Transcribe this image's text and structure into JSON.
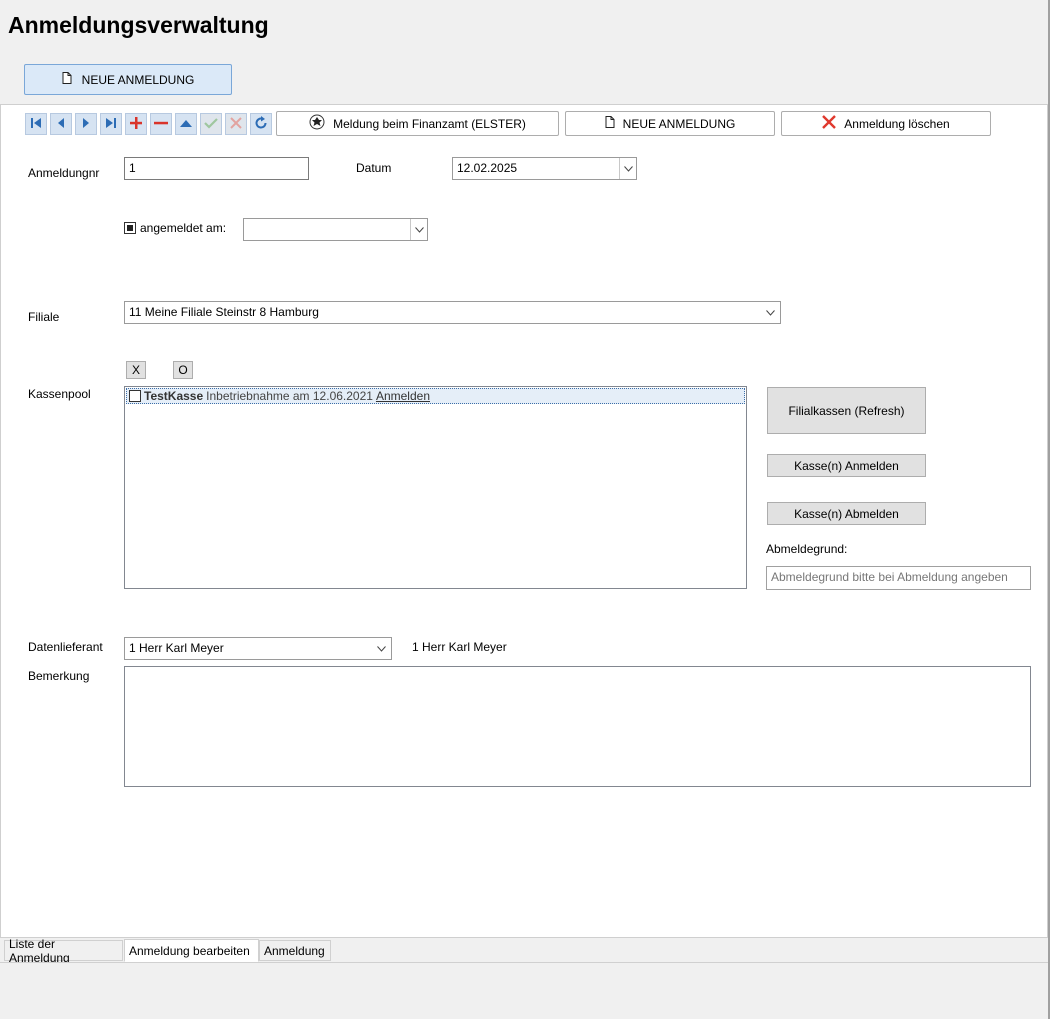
{
  "app": {
    "title": "Anmeldungsverwaltung"
  },
  "header": {
    "new_label": "NEUE ANMELDUNG"
  },
  "toolbar": {
    "elster_label": "Meldung beim Finanzamt (ELSTER)",
    "new_label": "NEUE ANMELDUNG",
    "delete_label": "Anmeldung löschen",
    "nav_icons": [
      "first-icon",
      "prev-icon",
      "next-icon",
      "last-icon",
      "add-icon",
      "remove-icon",
      "up-icon",
      "confirm-icon",
      "cancel-icon",
      "refresh-icon"
    ]
  },
  "form": {
    "anmeldungnr_label": "Anmeldungnr",
    "anmeldungnr_value": "1",
    "datum_label": "Datum",
    "datum_value": "12.02.2025",
    "angemeldet_label": "angemeldet am:",
    "angemeldet_value": "",
    "filiale_label": "Filiale",
    "filiale_value": "11 Meine Filiale Steinstr 8 Hamburg",
    "kassenpool_label": "Kassenpool",
    "x_label": "X",
    "o_label": "O",
    "kassen": [
      {
        "name": "TestKasse",
        "info": "Inbetriebnahme am 12.06.2021",
        "link": "Anmelden"
      }
    ],
    "refresh_label": "Filialkassen (Refresh)",
    "anmelden_label": "Kasse(n) Anmelden",
    "abmelden_label": "Kasse(n) Abmelden",
    "abmeldegrund_label": "Abmeldegrund:",
    "abmeldegrund_placeholder": "Abmeldegrund bitte bei Abmeldung angeben",
    "datenlieferant_label": "Datenlieferant",
    "datenlieferant_value": "1 Herr  Karl Meyer",
    "datenlieferant_display": "1 Herr  Karl Meyer",
    "bemerkung_label": "Bemerkung",
    "bemerkung_value": ""
  },
  "tabs": [
    {
      "label": "Liste der Anmeldung"
    },
    {
      "label": "Anmeldung bearbeiten"
    },
    {
      "label": "Anmeldung"
    }
  ]
}
